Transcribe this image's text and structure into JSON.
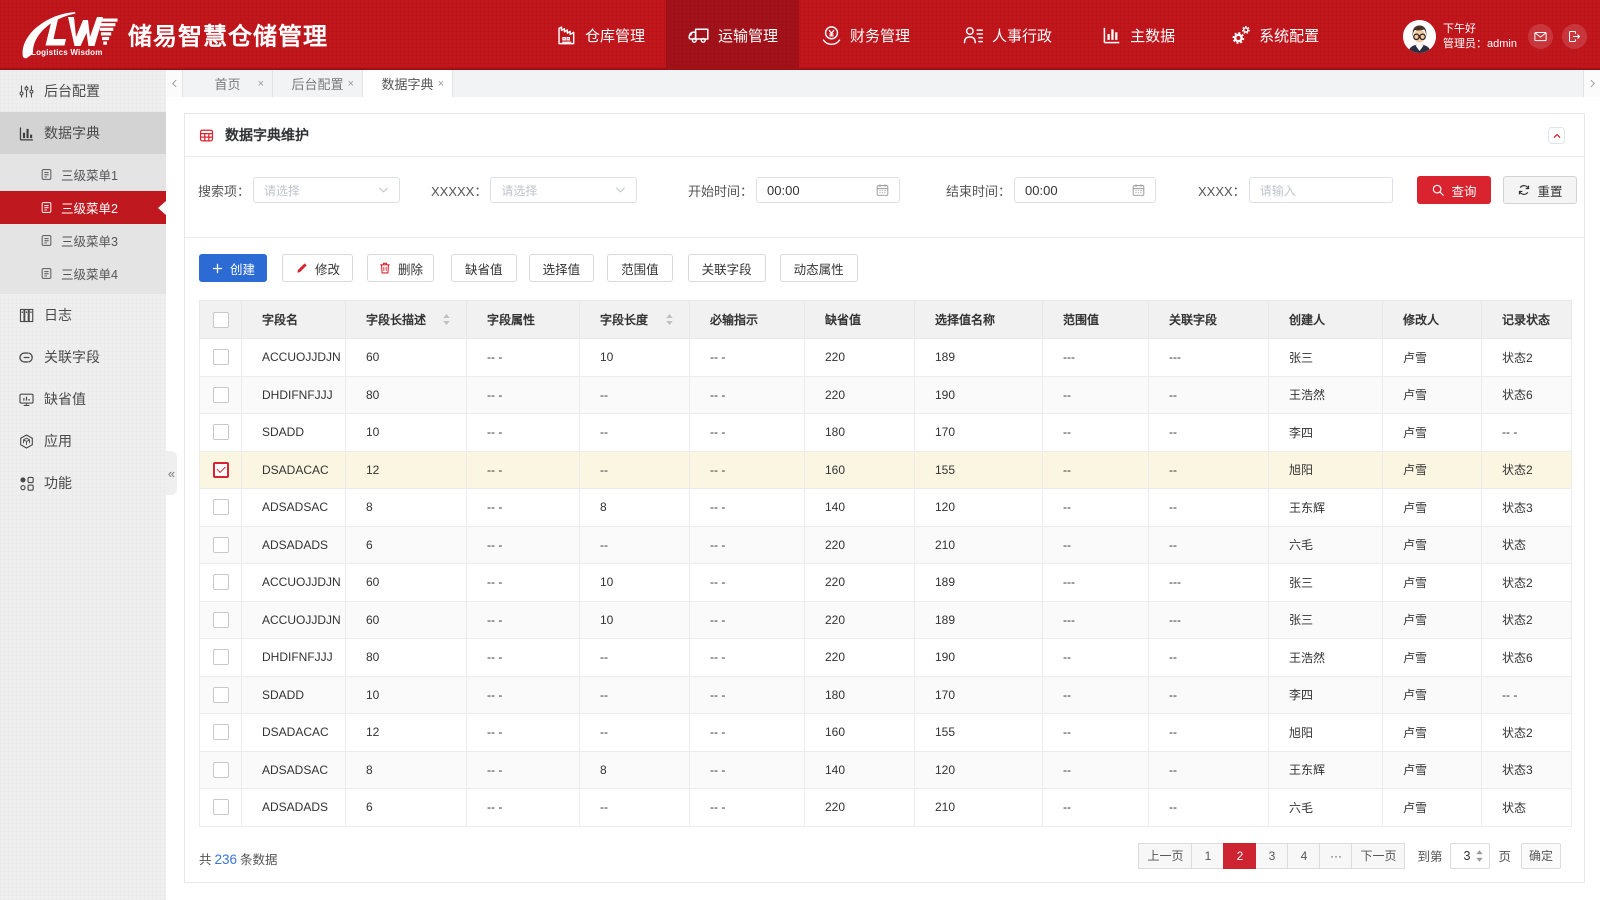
{
  "header": {
    "logo": {
      "monogram": "LW",
      "subtitle": "Logistics Wisdom"
    },
    "title": "储易智慧仓储管理",
    "nav": [
      {
        "label": "仓库管理",
        "icon": "warehouse-icon"
      },
      {
        "label": "运输管理",
        "icon": "truck-icon",
        "cls": "active"
      },
      {
        "label": "财务管理",
        "icon": "finance-icon"
      },
      {
        "label": "人事行政",
        "icon": "hr-icon"
      },
      {
        "label": "主数据",
        "icon": "masterdata-icon"
      },
      {
        "label": "系统配置",
        "icon": "gears-icon"
      }
    ],
    "user": {
      "greeting": "下午好",
      "role": "管理员：admin"
    },
    "colors": {
      "header_red": "#c2161d",
      "active_red": "#a3121a",
      "accent_red": "#d9232f",
      "primary_blue": "#2b6bd3"
    }
  },
  "sidebar": {
    "items_top": [
      {
        "label": "后台配置",
        "icon": "sliders-icon"
      },
      {
        "label": "数据字典",
        "icon": "barchart-icon",
        "cls": "open"
      }
    ],
    "submenu": [
      {
        "label": "三级菜单1",
        "icon": "doc-icon"
      },
      {
        "label": "三级菜单2",
        "icon": "doc-icon",
        "cls": "active"
      },
      {
        "label": "三级菜单3",
        "icon": "doc-icon"
      },
      {
        "label": "三级菜单4",
        "icon": "doc-icon"
      }
    ],
    "items_bottom": [
      {
        "label": "日志",
        "icon": "log-icon"
      },
      {
        "label": "关联字段",
        "icon": "link-icon"
      },
      {
        "label": "缺省值",
        "icon": "monitor-icon"
      },
      {
        "label": "应用",
        "icon": "app-icon"
      },
      {
        "label": "功能",
        "icon": "features-icon"
      }
    ],
    "collapse_glyph": "«"
  },
  "tabs": {
    "left_arrow": "‹",
    "right_arrow": "›",
    "items": [
      {
        "label": "首页",
        "close": "×"
      },
      {
        "label": "后台配置",
        "close": "×"
      },
      {
        "label": "数据字典",
        "close": "×",
        "cls": "active"
      }
    ]
  },
  "card": {
    "title": "数据字典维护",
    "search": {
      "fields": [
        {
          "label": "搜索项：",
          "placeholder": "请选择",
          "type": "select"
        },
        {
          "label": "XXXXX：",
          "placeholder": "请选择",
          "type": "select"
        },
        {
          "label": "开始时间：",
          "value": "00:00",
          "type": "time"
        },
        {
          "label": "结束时间：",
          "value": "00:00",
          "type": "time"
        },
        {
          "label": "XXXX：",
          "placeholder": "请输入",
          "type": "text"
        }
      ],
      "query_label": "查询",
      "reset_label": "重置"
    },
    "toolbar": {
      "create": "创建",
      "edit": "修改",
      "delete": "删除",
      "b4": "缺省值",
      "b5": "选择值",
      "b6": "范围值",
      "b7": "关联字段",
      "b8": "动态属性"
    },
    "table": {
      "columns": [
        {
          "label": "字段名"
        },
        {
          "label": "字段长描述",
          "sort": "sortable"
        },
        {
          "label": "字段属性"
        },
        {
          "label": "字段长度",
          "sort": "sortable"
        },
        {
          "label": "必输指示"
        },
        {
          "label": "缺省值"
        },
        {
          "label": "选择值名称"
        },
        {
          "label": "范围值"
        },
        {
          "label": "关联字段"
        },
        {
          "label": "创建人"
        },
        {
          "label": "修改人"
        },
        {
          "label": "记录状态"
        }
      ],
      "rows": [
        {
          "cells": [
            "ACCUOJJDJN",
            "60",
            "-- -",
            "10",
            "-- -",
            "220",
            "189",
            "---",
            "---",
            "张三",
            "卢雪",
            "状态2"
          ]
        },
        {
          "cells": [
            "DHDIFNFJJJ",
            "80",
            "-- -",
            "--",
            "-- -",
            "220",
            "190",
            "--",
            "--",
            "王浩然",
            "卢雪",
            "状态6"
          ]
        },
        {
          "cells": [
            "SDADD",
            "10",
            "-- -",
            "--",
            "-- -",
            "180",
            "170",
            "--",
            "--",
            "李四",
            "卢雪",
            "-- -"
          ]
        },
        {
          "cells": [
            "DSADACAC",
            "12",
            "-- -",
            "--",
            "-- -",
            "160",
            "155",
            "--",
            "--",
            "旭阳",
            "卢雪",
            "状态2"
          ],
          "cls": "hl",
          "checked": "on"
        },
        {
          "cells": [
            "ADSADSAC",
            "8",
            "-- -",
            "8",
            "-- -",
            "140",
            "120",
            "--",
            "--",
            "王东辉",
            "卢雪",
            "状态3"
          ]
        },
        {
          "cells": [
            "ADSADADS",
            "6",
            "-- -",
            "--",
            "-- -",
            "220",
            "210",
            "--",
            "--",
            "六毛",
            "卢雪",
            "状态"
          ]
        },
        {
          "cells": [
            "ACCUOJJDJN",
            "60",
            "-- -",
            "10",
            "-- -",
            "220",
            "189",
            "---",
            "---",
            "张三",
            "卢雪",
            "状态2"
          ]
        },
        {
          "cells": [
            "ACCUOJJDJN",
            "60",
            "-- -",
            "10",
            "-- -",
            "220",
            "189",
            "---",
            "---",
            "张三",
            "卢雪",
            "状态2"
          ]
        },
        {
          "cells": [
            "DHDIFNFJJJ",
            "80",
            "-- -",
            "--",
            "-- -",
            "220",
            "190",
            "--",
            "--",
            "王浩然",
            "卢雪",
            "状态6"
          ]
        },
        {
          "cells": [
            "SDADD",
            "10",
            "-- -",
            "--",
            "-- -",
            "180",
            "170",
            "--",
            "--",
            "李四",
            "卢雪",
            "-- -"
          ]
        },
        {
          "cells": [
            "DSADACAC",
            "12",
            "-- -",
            "--",
            "-- -",
            "160",
            "155",
            "--",
            "--",
            "旭阳",
            "卢雪",
            "状态2"
          ]
        },
        {
          "cells": [
            "ADSADSAC",
            "8",
            "-- -",
            "8",
            "-- -",
            "140",
            "120",
            "--",
            "--",
            "王东辉",
            "卢雪",
            "状态3"
          ]
        },
        {
          "cells": [
            "ADSADADS",
            "6",
            "-- -",
            "--",
            "-- -",
            "220",
            "210",
            "--",
            "--",
            "六毛",
            "卢雪",
            "状态"
          ]
        }
      ]
    },
    "footer": {
      "count_prefix": "共",
      "count": "236",
      "count_suffix": "条数据",
      "pages": [
        {
          "label": "上一页"
        },
        {
          "label": "1"
        },
        {
          "label": "2",
          "cls": "active"
        },
        {
          "label": "3"
        },
        {
          "label": "4"
        },
        {
          "label": "···"
        },
        {
          "label": "下一页"
        }
      ],
      "goto_prefix": "到第",
      "goto_value": "3",
      "goto_suffix": "页",
      "ok_label": "确定"
    }
  }
}
